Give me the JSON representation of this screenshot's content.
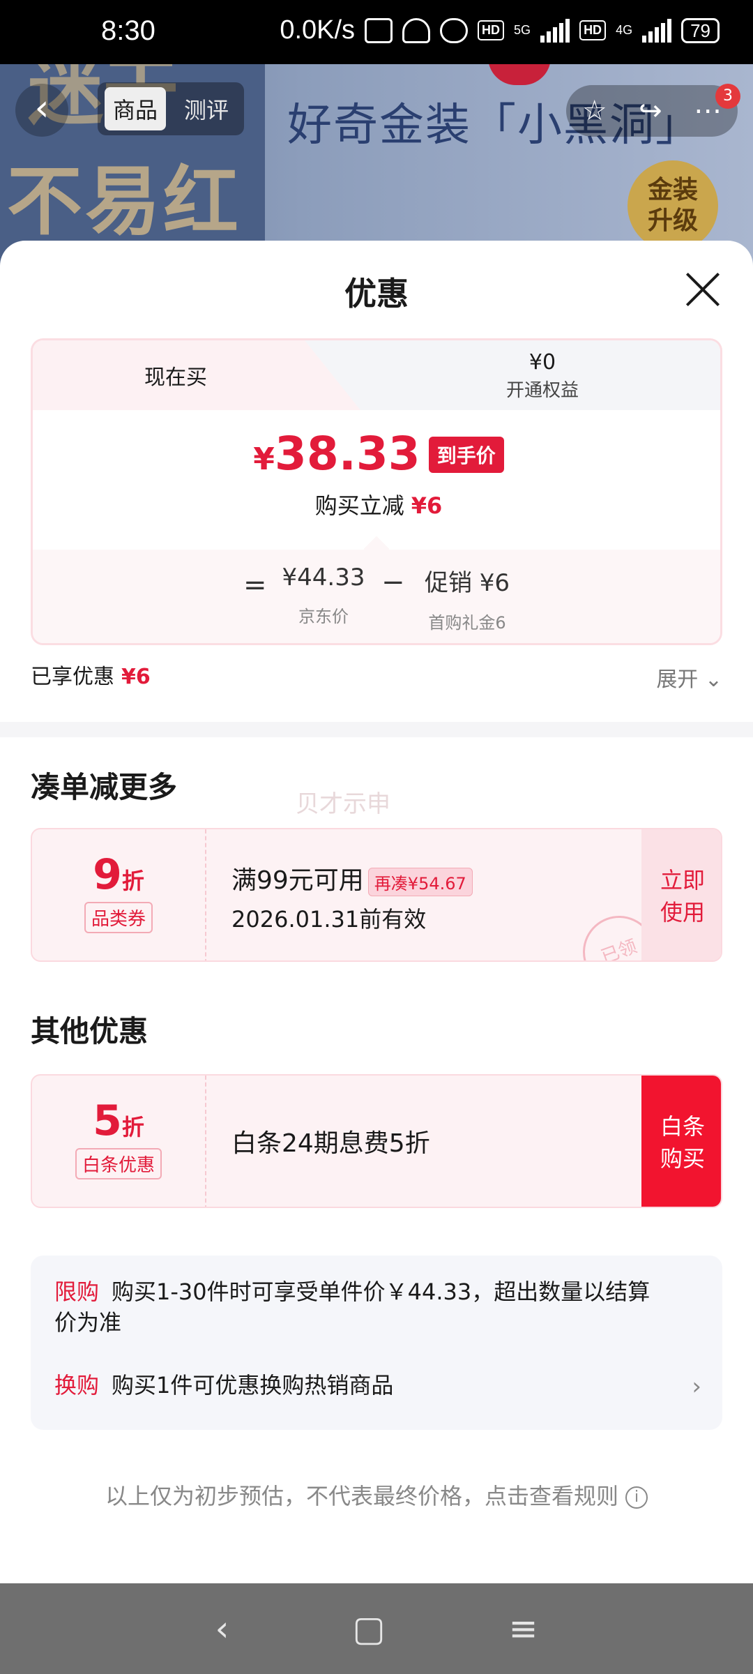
{
  "status_bar": {
    "time": "8:30",
    "net_speed": "0.0K/s",
    "net1": "5G",
    "net2": "4G",
    "hd": "HD",
    "battery": "79"
  },
  "banner": {
    "tab_product": "商品",
    "tab_review": "测评",
    "title": "好奇金装「小黑洞」",
    "slogan": "不易红",
    "badge": "金装升级",
    "notify_count": "3"
  },
  "sheet": {
    "title": "优惠",
    "tab_now": "现在买",
    "tab_member_value": "¥0",
    "tab_member_label": "开通权益",
    "price_currency": "¥",
    "price_value": "38.33",
    "price_tag": "到手价",
    "discount_label": "购买立减",
    "discount_value": "¥6",
    "eq": "=",
    "minus": "−",
    "base_price": "¥44.33",
    "base_label": "京东价",
    "promo_value": "促销 ¥6",
    "promo_label": "首购礼金6",
    "enjoyed_label": "已享优惠",
    "enjoyed_value": "¥6",
    "expand": "展开 ⌄"
  },
  "section_more": {
    "title": "凑单减更多",
    "watermark": "贝才示申",
    "coupon": {
      "rate": "9",
      "unit": "折",
      "type": "品类券",
      "condition": "满99元可用",
      "gap": "再凑¥54.67",
      "valid": "2026.01.31前有效",
      "action": "立即使用",
      "stamp": "已领"
    }
  },
  "section_other": {
    "title": "其他优惠",
    "coupon": {
      "rate": "5",
      "unit": "折",
      "type": "白条优惠",
      "desc": "白条24期息费5折",
      "action": "白条购买"
    }
  },
  "info": {
    "limit_key": "限购",
    "limit_text": "购买1-30件时可享受单件价￥44.33，超出数量以结算",
    "limit_text2": "价为准",
    "exchange_key": "换购",
    "exchange_text": "购买1件可优惠换购热销商品"
  },
  "disclaimer": "以上仅为初步预估，不代表最终价格，点击查看规则",
  "nav": {
    "back": "‹",
    "home": "▢",
    "menu": "≡"
  },
  "colors": {
    "accent": "#e21b3a",
    "coupon_bg": "#fdf2f4"
  }
}
